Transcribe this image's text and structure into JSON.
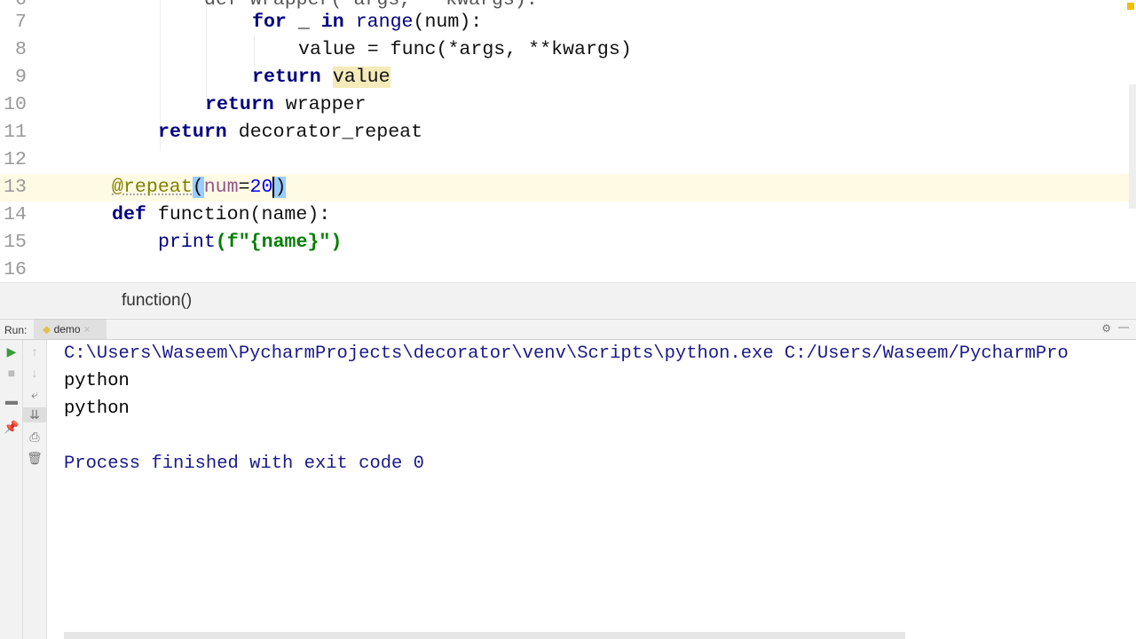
{
  "editor": {
    "lines": [
      {
        "n": "6",
        "text": "def wrapper(*args, **kwargs):"
      },
      {
        "n": "7"
      },
      {
        "n": "8"
      },
      {
        "n": "9"
      },
      {
        "n": "10"
      },
      {
        "n": "11"
      },
      {
        "n": "12"
      },
      {
        "n": "13"
      },
      {
        "n": "14"
      },
      {
        "n": "15"
      },
      {
        "n": "16"
      }
    ],
    "tokens": {
      "for": "for",
      "under": "_",
      "in": "in",
      "range": "range",
      "num_paren": "(num):",
      "value_assign": "value = func(*args, **kwargs)",
      "return": "return",
      "value": "value",
      "wrapper": "wrapper",
      "decorator_repeat": "decorator_repeat",
      "at_repeat": "@repeat",
      "lparen": "(",
      "num_kw": "num",
      "eq": "=",
      "twenty": "20",
      "rparen": ")",
      "def": "def",
      "function_sig": "function(name):",
      "print": "print",
      "print_args": "(f\"{name}\")"
    }
  },
  "breadcrumb": "function()",
  "run": {
    "label": "Run:",
    "tab": "demo",
    "output": [
      "C:\\Users\\Waseem\\PycharmProjects\\decorator\\venv\\Scripts\\python.exe C:/Users/Waseem/PycharmPro",
      "python",
      "python",
      "",
      "Process finished with exit code 0"
    ]
  }
}
